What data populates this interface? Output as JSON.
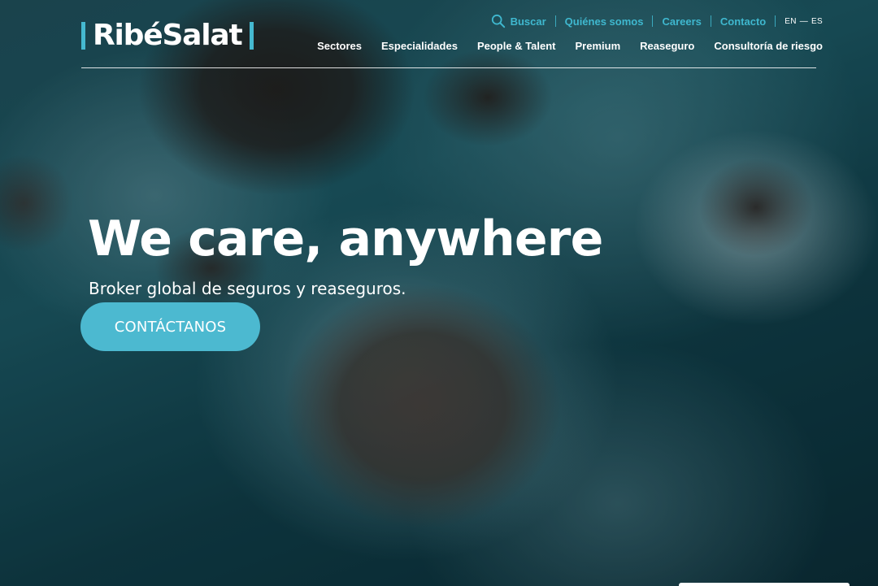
{
  "brand": {
    "name": "RibéSalat",
    "accent_color": "#45b9d0"
  },
  "topnav": {
    "search_label": "Buscar",
    "links": [
      "Quiénes somos",
      "Careers",
      "Contacto"
    ],
    "lang": {
      "en": "EN",
      "sep": "—",
      "es": "ES"
    }
  },
  "mainnav": {
    "items": [
      "Sectores",
      "Especialidades",
      "People & Talent",
      "Premium",
      "Reaseguro",
      "Consultoría de riesgo"
    ]
  },
  "hero": {
    "headline": "We care, anywhere",
    "subheadline": "Broker global de seguros y reaseguros.",
    "cta_label": "CONTÁCTANOS"
  },
  "icons": {
    "search": "search-icon"
  }
}
